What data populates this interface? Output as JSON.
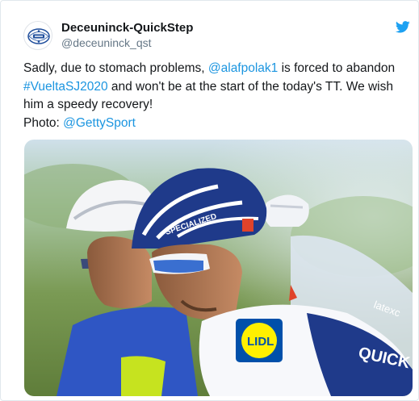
{
  "account": {
    "display_name": "Deceuninck-QuickStep",
    "handle": "@deceuninck_qst",
    "avatar_icon": "team-crest-icon",
    "platform_icon": "twitter-bird-icon"
  },
  "tweet": {
    "line1_text": "Sadly, due to stomach problems, ",
    "mention_rider": "@alafpolak1",
    "line1_tail": " is forced to abandon",
    "hashtag": "#VueltaSJ2020",
    "line2_tail": " and won't be at the start of the today's TT. We wish",
    "line3": "him a speedy recovery!",
    "photo_label": "Photo: ",
    "mention_photo": "@GettySport"
  },
  "photo": {
    "helmet_text": "SPECIALIZED",
    "jersey_sponsor": "LIDL",
    "jersey_brand": "QUICK",
    "jersey_sleeve": "latexc"
  },
  "colors": {
    "link": "#1b95e0",
    "twitter_blue": "#1da1f2",
    "jersey_blue": "#1f3a8a"
  }
}
